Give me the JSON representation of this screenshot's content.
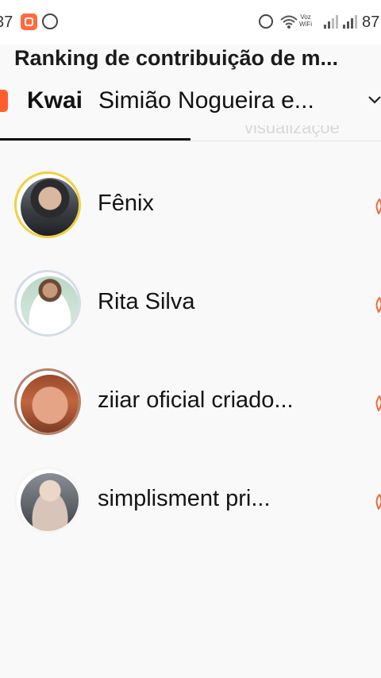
{
  "status_bar": {
    "time": "37",
    "network_label_top": "Voz",
    "network_label_bottom": "WiFi",
    "battery": "87"
  },
  "header": {
    "title": "Ranking de contribuição de m...",
    "platform": "Kwai",
    "creator": "Simião Nogueira e..."
  },
  "sort_hint": "visualizaçõe",
  "colors": {
    "accent": "#ff5d2c",
    "flame": "#ee6a3a",
    "gold_ring": "#f2d03b",
    "pink_ring": "#d5a8b1"
  },
  "ranking": [
    {
      "name": "Fênix",
      "avatar_icon": "avatar-woman-dark-hair",
      "ring": "gold"
    },
    {
      "name": "Rita Silva",
      "avatar_icon": "avatar-woman-white-dress",
      "ring": "silver"
    },
    {
      "name": "ziiar oficial criado...",
      "avatar_icon": "avatar-woman-smiling",
      "ring": "bronze"
    },
    {
      "name": "simplisment pri...",
      "avatar_icon": "avatar-cat-dress",
      "ring": "none"
    }
  ]
}
